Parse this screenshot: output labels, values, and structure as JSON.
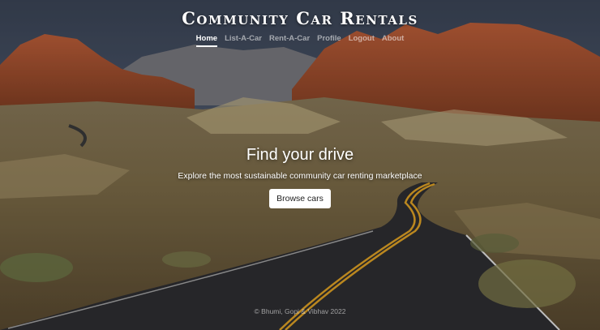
{
  "header": {
    "title": "Community Car Rentals"
  },
  "nav": {
    "items": [
      {
        "label": "Home",
        "active": true
      },
      {
        "label": "List-A-Car",
        "active": false
      },
      {
        "label": "Rent-A-Car",
        "active": false
      },
      {
        "label": "Profile",
        "active": false
      },
      {
        "label": "Logout",
        "active": false
      },
      {
        "label": "About",
        "active": false
      }
    ]
  },
  "hero": {
    "heading": "Find your drive",
    "subheading": "Explore the most sustainable community car renting marketplace",
    "button_label": "Browse cars"
  },
  "footer": {
    "text": "© Bhumi, Gopi & Vibhav 2022"
  },
  "colors": {
    "sky": "#5d6a80",
    "rock": "#b5502c",
    "road": "#2f2f33",
    "road_line": "#e3a526"
  }
}
